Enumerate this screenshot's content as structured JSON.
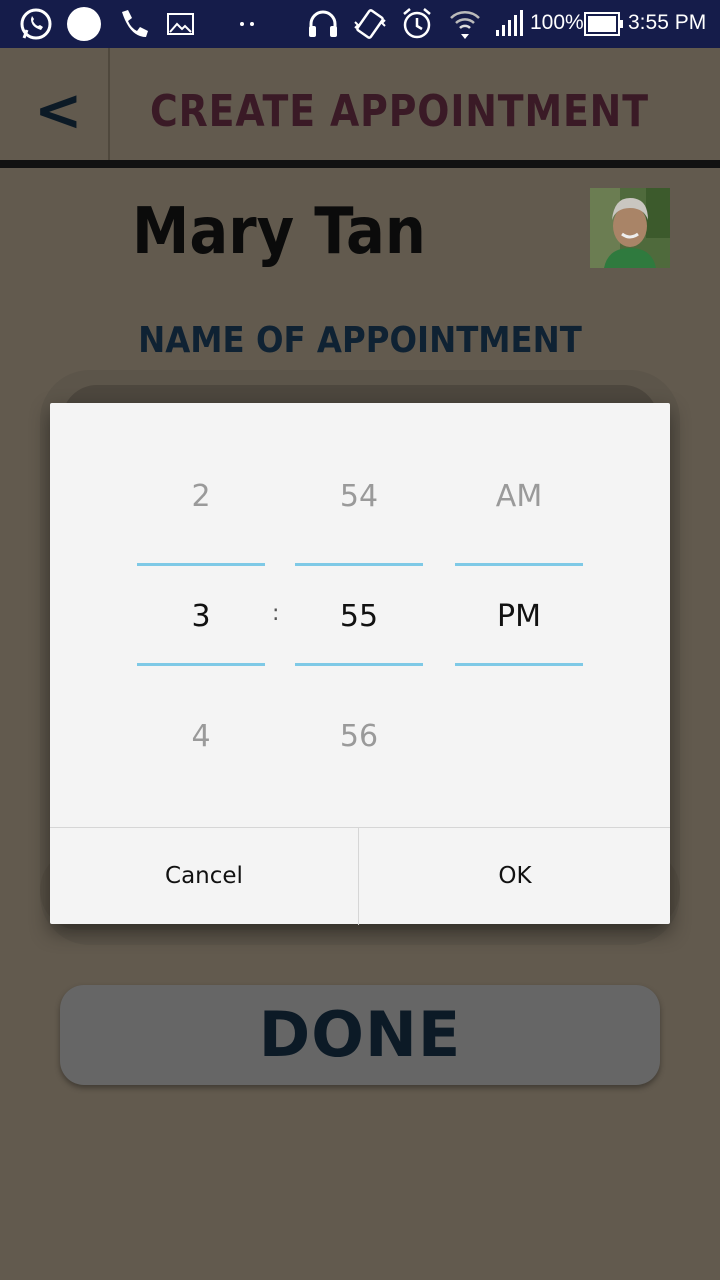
{
  "status_bar": {
    "battery_percent": "100%",
    "time": "3:55 PM",
    "icons": [
      "whatsapp-icon",
      "circle-icon",
      "phone-icon",
      "image-icon",
      "dots-icon",
      "headphones-icon",
      "vibrate-icon",
      "alarm-icon",
      "wifi-icon",
      "signal-icon",
      "battery-icon"
    ]
  },
  "header": {
    "back_label": "<",
    "title": "CREATE APPOINTMENT"
  },
  "patient": {
    "name": "Mary Tan"
  },
  "form": {
    "appointment_label": "NAME OF APPOINTMENT"
  },
  "time_picker": {
    "hour": {
      "prev": "2",
      "selected": "3",
      "next": "4"
    },
    "separator": ":",
    "minute": {
      "prev": "54",
      "selected": "55",
      "next": "56"
    },
    "ampm": {
      "prev": "AM",
      "selected": "PM"
    },
    "cancel_label": "Cancel",
    "ok_label": "OK",
    "accent_color": "#7ec9e6"
  },
  "done_label": "DONE"
}
